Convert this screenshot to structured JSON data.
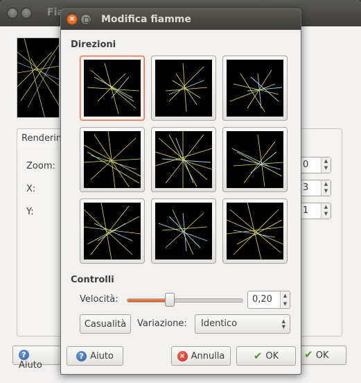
{
  "background_window": {
    "title": "Fia",
    "tab_label": "Renderin",
    "labels": {
      "zoom": "Zoom:",
      "x": "X:",
      "y": "Y:"
    },
    "spin_values": {
      "zoom": "0",
      "x": "3",
      "y": "1"
    },
    "help_button": "Aiuto",
    "ok_button": "OK"
  },
  "dialog": {
    "title": "Modifica fiamme",
    "directions_title": "Direzioni",
    "thumbnails": [
      {
        "name": "top-left",
        "selected": true
      },
      {
        "name": "top"
      },
      {
        "name": "top-right"
      },
      {
        "name": "left"
      },
      {
        "name": "center"
      },
      {
        "name": "right"
      },
      {
        "name": "bottom-left"
      },
      {
        "name": "bottom"
      },
      {
        "name": "bottom-right"
      }
    ],
    "controls_title": "Controlli",
    "speed_label": "Velocità:",
    "speed_value": "0,20",
    "speed_fraction": 0.37,
    "random_button": "Casualità",
    "variation_label": "Variazione:",
    "variation_selected": "Identico",
    "help_button": "Aiuto",
    "cancel_button": "Annulla",
    "ok_button": "OK"
  },
  "colors": {
    "accent": "#e05818",
    "flame_yellow": "#e8e04a",
    "flame_blue": "#a8d8ec",
    "titlebar": "#3e3d39"
  }
}
